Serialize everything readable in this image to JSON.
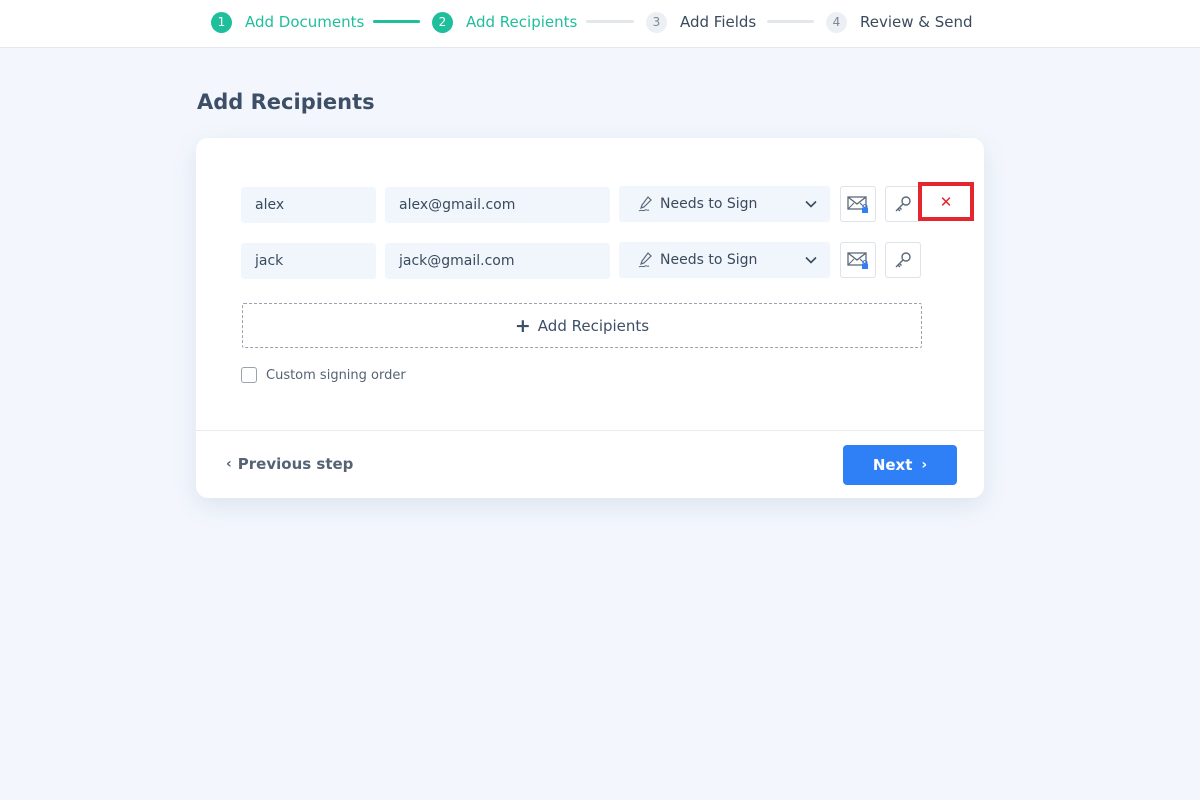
{
  "stepper": {
    "steps": [
      {
        "number": "1",
        "label": "Add Documents",
        "status": "done"
      },
      {
        "number": "2",
        "label": "Add Recipients",
        "status": "done"
      },
      {
        "number": "3",
        "label": "Add Fields",
        "status": "todo"
      },
      {
        "number": "4",
        "label": "Review & Send",
        "status": "todo"
      }
    ],
    "colors": {
      "done": "#1fbf9c",
      "todo": "#eceff3"
    }
  },
  "page_title": "Add Recipients",
  "recipients": [
    {
      "name": "alex",
      "email": "alex@gmail.com",
      "role": "Needs to Sign",
      "has_remove": true
    },
    {
      "name": "jack",
      "email": "jack@gmail.com",
      "role": "Needs to Sign",
      "has_remove": false
    }
  ],
  "icons": {
    "role": "signature-pen-icon",
    "dropdown": "chevron-down-icon",
    "email": "email-lock-icon",
    "access": "key-icon",
    "remove": "close-icon"
  },
  "remove_glyph": "✕",
  "add_recipients_label": "Add Recipients",
  "custom_signing_order_label": "Custom signing order",
  "footer": {
    "previous_label": "Previous step",
    "next_label": "Next"
  },
  "colors": {
    "primary": "#2f80f6",
    "highlight": "#e3262f"
  }
}
